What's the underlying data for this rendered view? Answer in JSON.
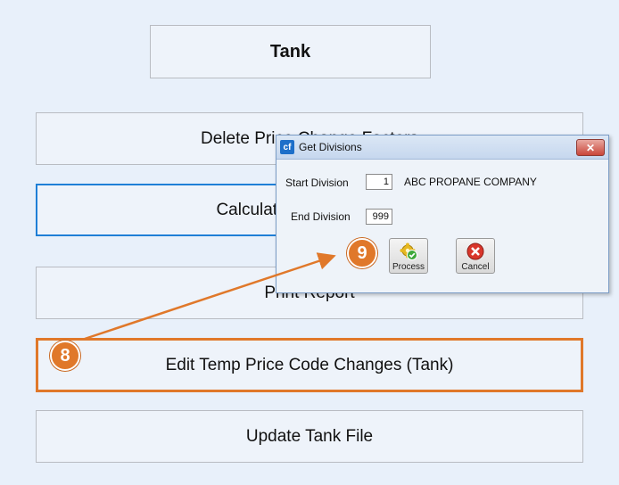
{
  "panel": {
    "title": "Tank",
    "delete_label": "Delete Price Change Factors",
    "calc_label": "Calculate Price Changes",
    "print_label": "Print Report",
    "edit_label": "Edit Temp Price Code Changes (Tank)",
    "update_label": "Update Tank File"
  },
  "dialog": {
    "app_icon": "cf",
    "title": "Get Divisions",
    "close_glyph": "✕",
    "start_label": "Start Division",
    "start_value": "1",
    "company": "ABC PROPANE COMPANY",
    "end_label": "End Division",
    "end_value": "999",
    "process_label": "Process",
    "cancel_label": "Cancel"
  },
  "annotations": {
    "step_8": "8",
    "step_9": "9",
    "color": "#e0782a"
  }
}
